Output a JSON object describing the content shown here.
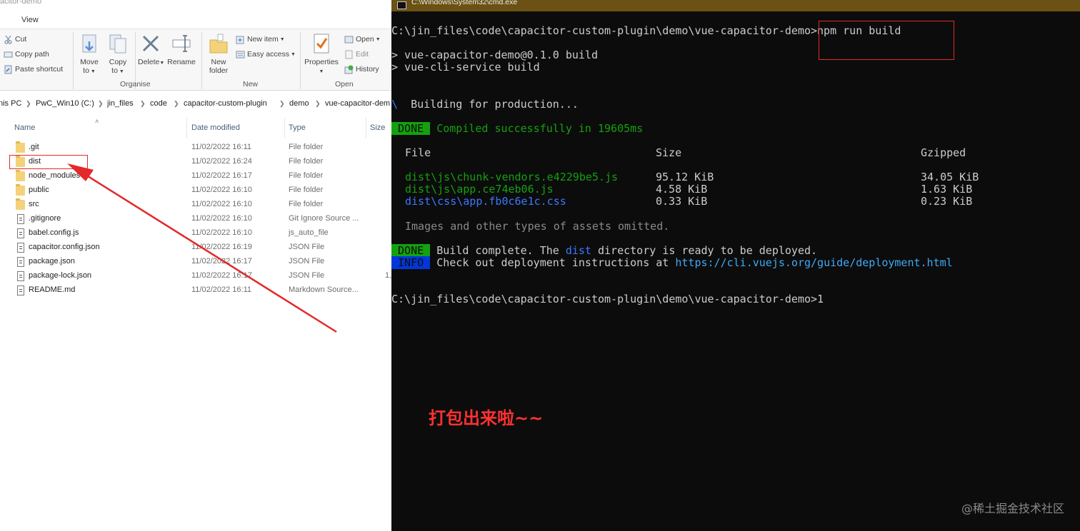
{
  "explorer": {
    "window_title": "acitor-demo",
    "menu": {
      "view": "View"
    },
    "ribbon": {
      "clipboard": {
        "cut": "Cut",
        "copy_path": "Copy path",
        "paste_shortcut": "Paste shortcut"
      },
      "organise": {
        "move_to": "Move",
        "move_to_sub": "to",
        "copy_to": "Copy",
        "copy_to_sub": "to",
        "delete": "Delete",
        "rename": "Rename",
        "group": "Organise"
      },
      "new": {
        "new_folder": "New",
        "new_folder_sub": "folder",
        "new_item": "New item",
        "easy_access": "Easy access",
        "group": "New"
      },
      "open": {
        "properties": "Properties",
        "open": "Open",
        "edit": "Edit",
        "history": "History",
        "group": "Open"
      }
    },
    "breadcrumb": [
      "nis PC",
      "PwC_Win10 (C:)",
      "jin_files",
      "code",
      "capacitor-custom-plugin",
      "demo",
      "vue-capacitor-dem"
    ],
    "columns": {
      "name": "Name",
      "date": "Date modified",
      "type": "Type",
      "size": "Size"
    },
    "files": [
      {
        "name": ".git",
        "date": "11/02/2022 16:11",
        "type": "File folder",
        "size": "",
        "icon": "folder-icon"
      },
      {
        "name": "dist",
        "date": "11/02/2022 16:24",
        "type": "File folder",
        "size": "",
        "icon": "folder-icon"
      },
      {
        "name": "node_modules",
        "date": "11/02/2022 16:17",
        "type": "File folder",
        "size": "",
        "icon": "folder-icon"
      },
      {
        "name": "public",
        "date": "11/02/2022 16:10",
        "type": "File folder",
        "size": "",
        "icon": "folder-icon"
      },
      {
        "name": "src",
        "date": "11/02/2022 16:10",
        "type": "File folder",
        "size": "",
        "icon": "folder-icon"
      },
      {
        "name": ".gitignore",
        "date": "11/02/2022 16:10",
        "type": "Git Ignore Source ...",
        "size": "",
        "icon": "file-icon"
      },
      {
        "name": "babel.config.js",
        "date": "11/02/2022 16:10",
        "type": "js_auto_file",
        "size": "",
        "icon": "file-icon"
      },
      {
        "name": "capacitor.config.json",
        "date": "11/02/2022 16:19",
        "type": "JSON File",
        "size": "",
        "icon": "json-file-icon"
      },
      {
        "name": "package.json",
        "date": "11/02/2022 16:17",
        "type": "JSON File",
        "size": "",
        "icon": "json-file-icon"
      },
      {
        "name": "package-lock.json",
        "date": "11/02/2022 16:17",
        "type": "JSON File",
        "size": "1,",
        "icon": "json-file-icon"
      },
      {
        "name": "README.md",
        "date": "11/02/2022 16:11",
        "type": "Markdown Source...",
        "size": "",
        "icon": "file-icon"
      }
    ]
  },
  "cmd": {
    "window_title": "C:\\Windows\\System32\\cmd.exe",
    "prompt1": "C:\\jin_files\\code\\capacitor-custom-plugin\\demo\\vue-capacitor-demo>",
    "command": "npm run build",
    "out1": "> vue-capacitor-demo@0.1.0 build",
    "out2": "> vue-cli-service build",
    "spinner": "\\",
    "building": "  Building for production...",
    "done_tag": " DONE ",
    "compiled": " Compiled successfully in 19605ms",
    "table_header": {
      "file": "File",
      "size": "Size",
      "gzipped": "Gzipped"
    },
    "assets": [
      {
        "file": "dist\\js\\chunk-vendors.e4229be5.js",
        "size": "95.12 KiB",
        "gzipped": "34.05 KiB",
        "color": "#13a10e"
      },
      {
        "file": "dist\\js\\app.ce74eb06.js",
        "size": "4.58 KiB",
        "gzipped": "1.63 KiB",
        "color": "#13a10e"
      },
      {
        "file": "dist\\css\\app.fb0c6e1c.css",
        "size": "0.33 KiB",
        "gzipped": "0.23 KiB",
        "color": "#3b78ff"
      }
    ],
    "omitted": "Images and other types of assets omitted.",
    "done2_pre": " Build complete. The ",
    "done2_dist": "dist",
    "done2_post": " directory is ready to be deployed.",
    "info_tag": " INFO ",
    "info_text": " Check out deployment instructions at ",
    "info_link": "https://cli.vuejs.org/guide/deployment.html",
    "prompt2": "C:\\jin_files\\code\\capacitor-custom-plugin\\demo\\vue-capacitor-demo>1"
  },
  "annotation": {
    "caption": "打包出来啦~~",
    "color": "#e32929"
  },
  "watermark": "@稀土掘金技术社区"
}
